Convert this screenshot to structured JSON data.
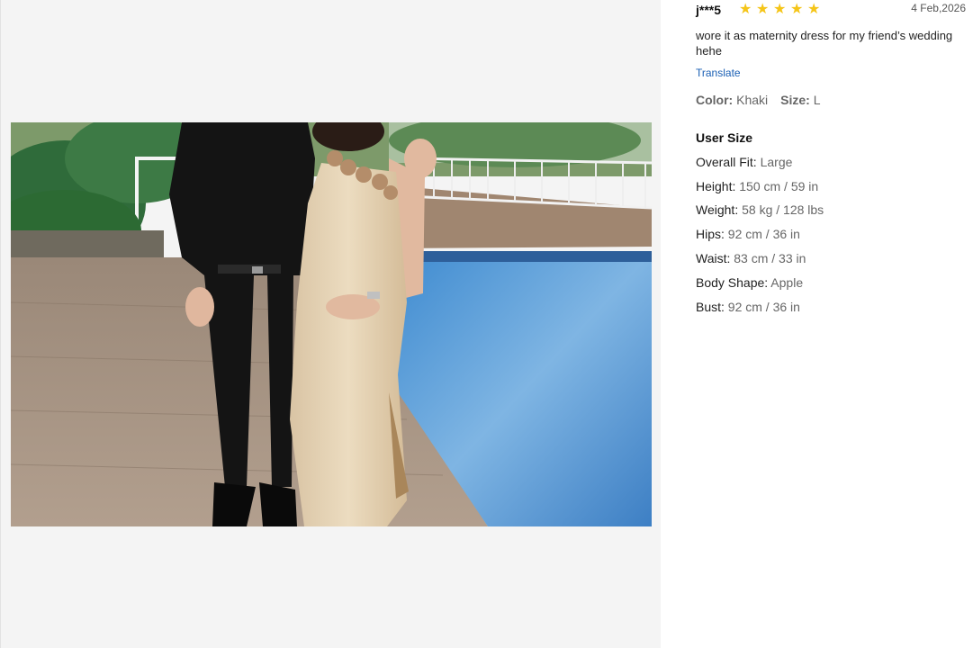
{
  "review": {
    "username": "j***5",
    "rating": 5,
    "stars": [
      "★",
      "★",
      "★",
      "★",
      "★"
    ],
    "date": "4 Feb,2026",
    "text": "wore it as maternity dress for my friend’s wedding hehe",
    "translate_label": "Translate",
    "sku": {
      "color_label": "Color:",
      "color_value": "Khaki",
      "size_label": "Size:",
      "size_value": "L"
    },
    "user_size": {
      "title": "User Size",
      "items": [
        {
          "label": "Overall Fit:",
          "value": "Large"
        },
        {
          "label": "Height:",
          "value": "150 cm / 59 in"
        },
        {
          "label": "Weight:",
          "value": "58 kg / 128 lbs"
        },
        {
          "label": "Hips:",
          "value": "92 cm / 36 in"
        },
        {
          "label": "Waist:",
          "value": "83 cm / 33 in"
        },
        {
          "label": "Body Shape:",
          "value": "Apple"
        },
        {
          "label": "Bust:",
          "value": "92 cm / 36 in"
        }
      ]
    }
  },
  "colors": {
    "star": "#f5c518",
    "link": "#1a5fb4",
    "panel_bg": "#f4f4f4"
  }
}
